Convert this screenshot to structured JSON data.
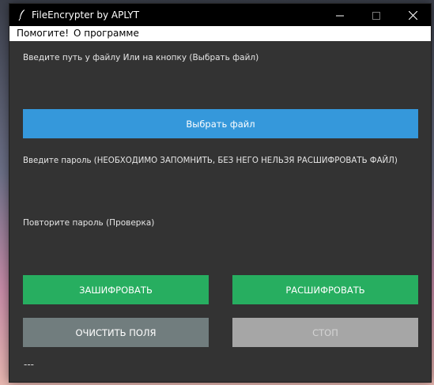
{
  "window": {
    "title": "FileEncrypter by APLYT",
    "icons": {
      "app": "feather-icon",
      "minimize": "minimize-icon",
      "maximize": "maximize-icon",
      "close": "close-icon"
    }
  },
  "menu": {
    "items": [
      {
        "label": "Помогите!"
      },
      {
        "label": "О программе"
      }
    ]
  },
  "form": {
    "file_prompt": "Введите путь у файлу Или на кнопку (Выбрать файл)",
    "choose_file_label": "Выбрать файл",
    "password_prompt": "Введите пароль (НЕОБХОДИМО ЗАПОМНИТЬ, БЕЗ НЕГО НЕЛЬЗЯ РАСШИФРОВАТЬ ФАЙЛ)",
    "repeat_prompt": "Повторите пароль (Проверка)"
  },
  "actions": {
    "encrypt_label": "ЗАШИФРОВАТЬ",
    "decrypt_label": "РАСШИФРОВАТЬ",
    "clear_label": "ОЧИСТИТЬ ПОЛЯ",
    "stop_label": "СТОП"
  },
  "status": {
    "text": "---"
  },
  "colors": {
    "window_bg": "#333333",
    "titlebar_bg": "#000000",
    "choose_button": "#3598db",
    "encrypt_button": "#27ae60",
    "decrypt_button": "#27ae60",
    "clear_button": "#717d7e",
    "stop_button": "#a6a6a6",
    "stop_text": "#d4d4d4"
  }
}
